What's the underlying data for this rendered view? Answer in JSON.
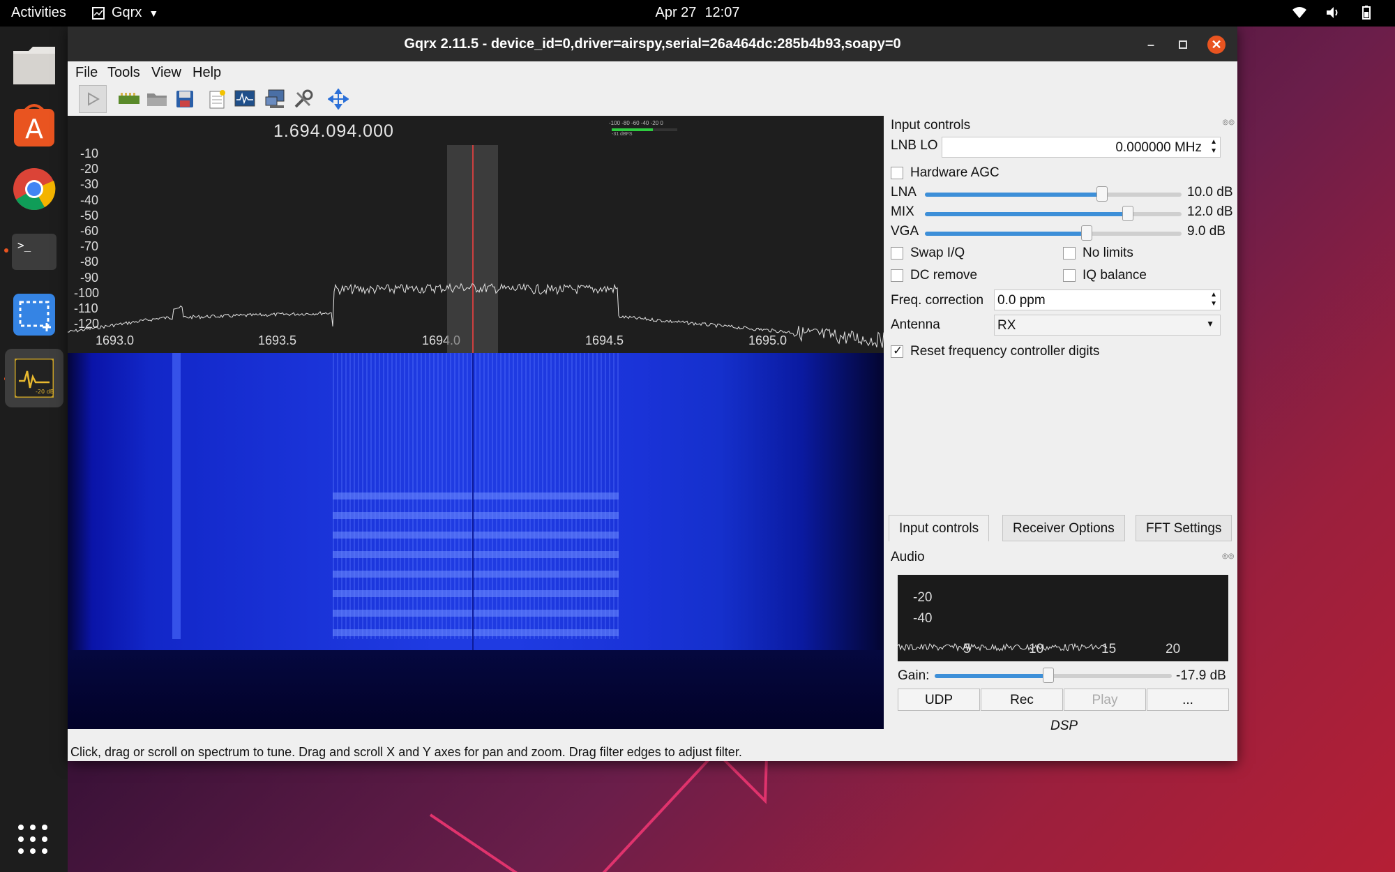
{
  "topbar": {
    "activities": "Activities",
    "app_name": "Gqrx",
    "date": "Apr 27",
    "time": "12:07"
  },
  "window": {
    "title": "Gqrx 2.11.5 - device_id=0,driver=airspy,serial=26a464dc:285b4b93,soapy=0"
  },
  "menu": {
    "file": "File",
    "tools": "Tools",
    "view": "View",
    "help": "Help"
  },
  "toolbar": {
    "icons": [
      "play-icon",
      "hardware-icon",
      "open-icon",
      "save-icon",
      "bookmark-icon",
      "waveform-icon",
      "remote-icon",
      "settings-icon",
      "fullscreen-icon"
    ]
  },
  "spectrum": {
    "frequency": "1.694.094.000",
    "y_ticks": [
      "-10",
      "-20",
      "-30",
      "-40",
      "-50",
      "-60",
      "-70",
      "-80",
      "-90",
      "-100",
      "-110",
      "-120"
    ],
    "x_ticks": [
      "1693.0",
      "1693.5",
      "1694.0",
      "1694.5",
      "1695.0"
    ],
    "meter_scale": "-100 -80 -60 -40 -20 0",
    "meter_value": "-31 dBFS"
  },
  "status": {
    "text": "Click, drag or scroll on spectrum to tune. Drag and scroll X and Y axes for pan and zoom. Drag filter edges to adjust filter."
  },
  "input_controls": {
    "title": "Input controls",
    "lnb_label": "LNB LO",
    "lnb_value": "0.000000 MHz",
    "hw_agc": "Hardware AGC",
    "lna_label": "LNA",
    "lna_value": "10.0 dB",
    "lna_level": 0.69,
    "mix_label": "MIX",
    "mix_value": "12.0 dB",
    "mix_level": 0.79,
    "vga_label": "VGA",
    "vga_value": "9.0 dB",
    "vga_level": 0.63,
    "swap_iq": "Swap I/Q",
    "no_limits": "No limits",
    "dc_remove": "DC remove",
    "iq_balance": "IQ balance",
    "freq_corr_label": "Freq. correction",
    "freq_corr_value": "0.0 ppm",
    "antenna_label": "Antenna",
    "antenna_value": "RX",
    "reset_digits": "Reset frequency controller digits"
  },
  "tabs": {
    "input": "Input controls",
    "receiver": "Receiver Options",
    "fft": "FFT Settings"
  },
  "audio": {
    "title": "Audio",
    "y_ticks": [
      "-20",
      "-40"
    ],
    "x_ticks": [
      "5",
      "10",
      "15",
      "20"
    ],
    "gain_label": "Gain:",
    "gain_value": "-17.9 dB",
    "gain_level": 0.48,
    "udp": "UDP",
    "rec": "Rec",
    "play": "Play",
    "more": "...",
    "dsp": "DSP"
  },
  "colors": {
    "accent": "#3d8fd8",
    "waterfall": "#1a2ee0",
    "close_button": "#e95420"
  }
}
